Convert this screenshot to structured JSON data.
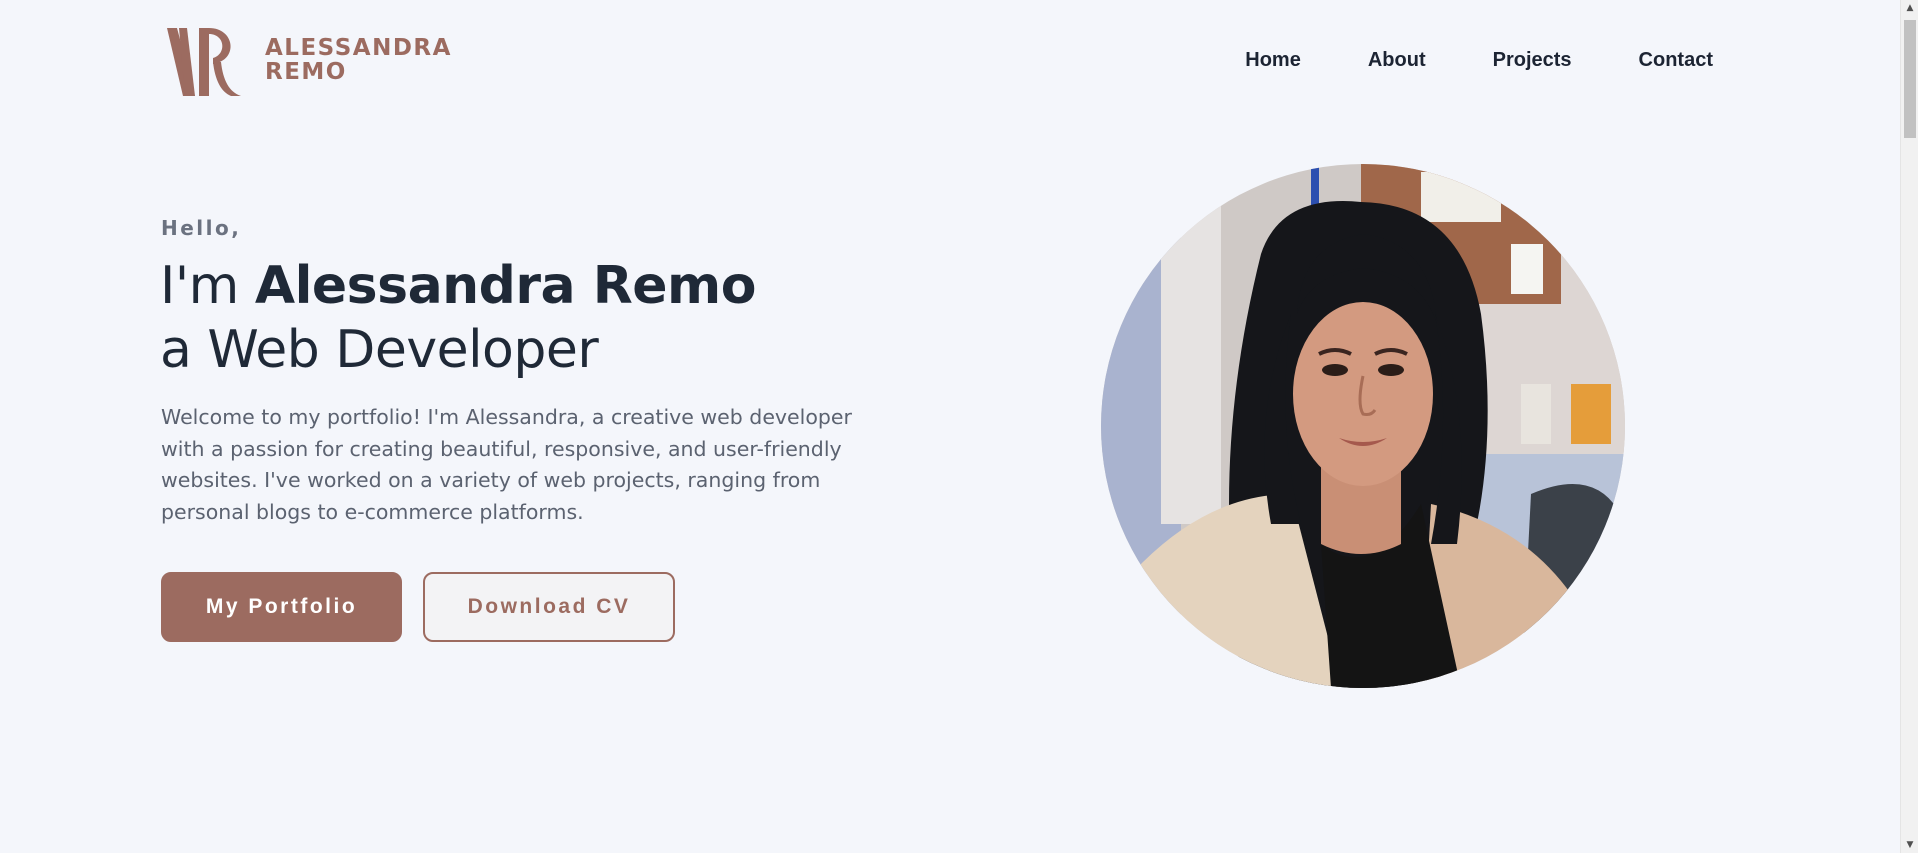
{
  "header": {
    "logo": {
      "mark": "AR",
      "line1": "ALESSANDRA",
      "line2": "REMO"
    },
    "nav": [
      {
        "label": "Home"
      },
      {
        "label": "About"
      },
      {
        "label": "Projects"
      },
      {
        "label": "Contact"
      }
    ]
  },
  "hero": {
    "greeting": "Hello,",
    "headline_prefix": "I'm ",
    "name": "Alessandra Remo",
    "role_line": "a Web Developer",
    "intro": "Welcome to my portfolio! I'm Alessandra, a creative web developer with a passion for creating beautiful, responsive, and user-friendly websites. I've worked on a variety of web projects, ranging from personal blogs to e-commerce platforms.",
    "primary_button": "My Portfolio",
    "secondary_button": "Download CV"
  },
  "colors": {
    "brand": "#9c6b60",
    "background": "#f4f6fb",
    "heading": "#1f2937",
    "body_text": "#5b6270"
  },
  "scrollbar": {
    "up_arrow": "▲",
    "down_arrow": "▼"
  }
}
